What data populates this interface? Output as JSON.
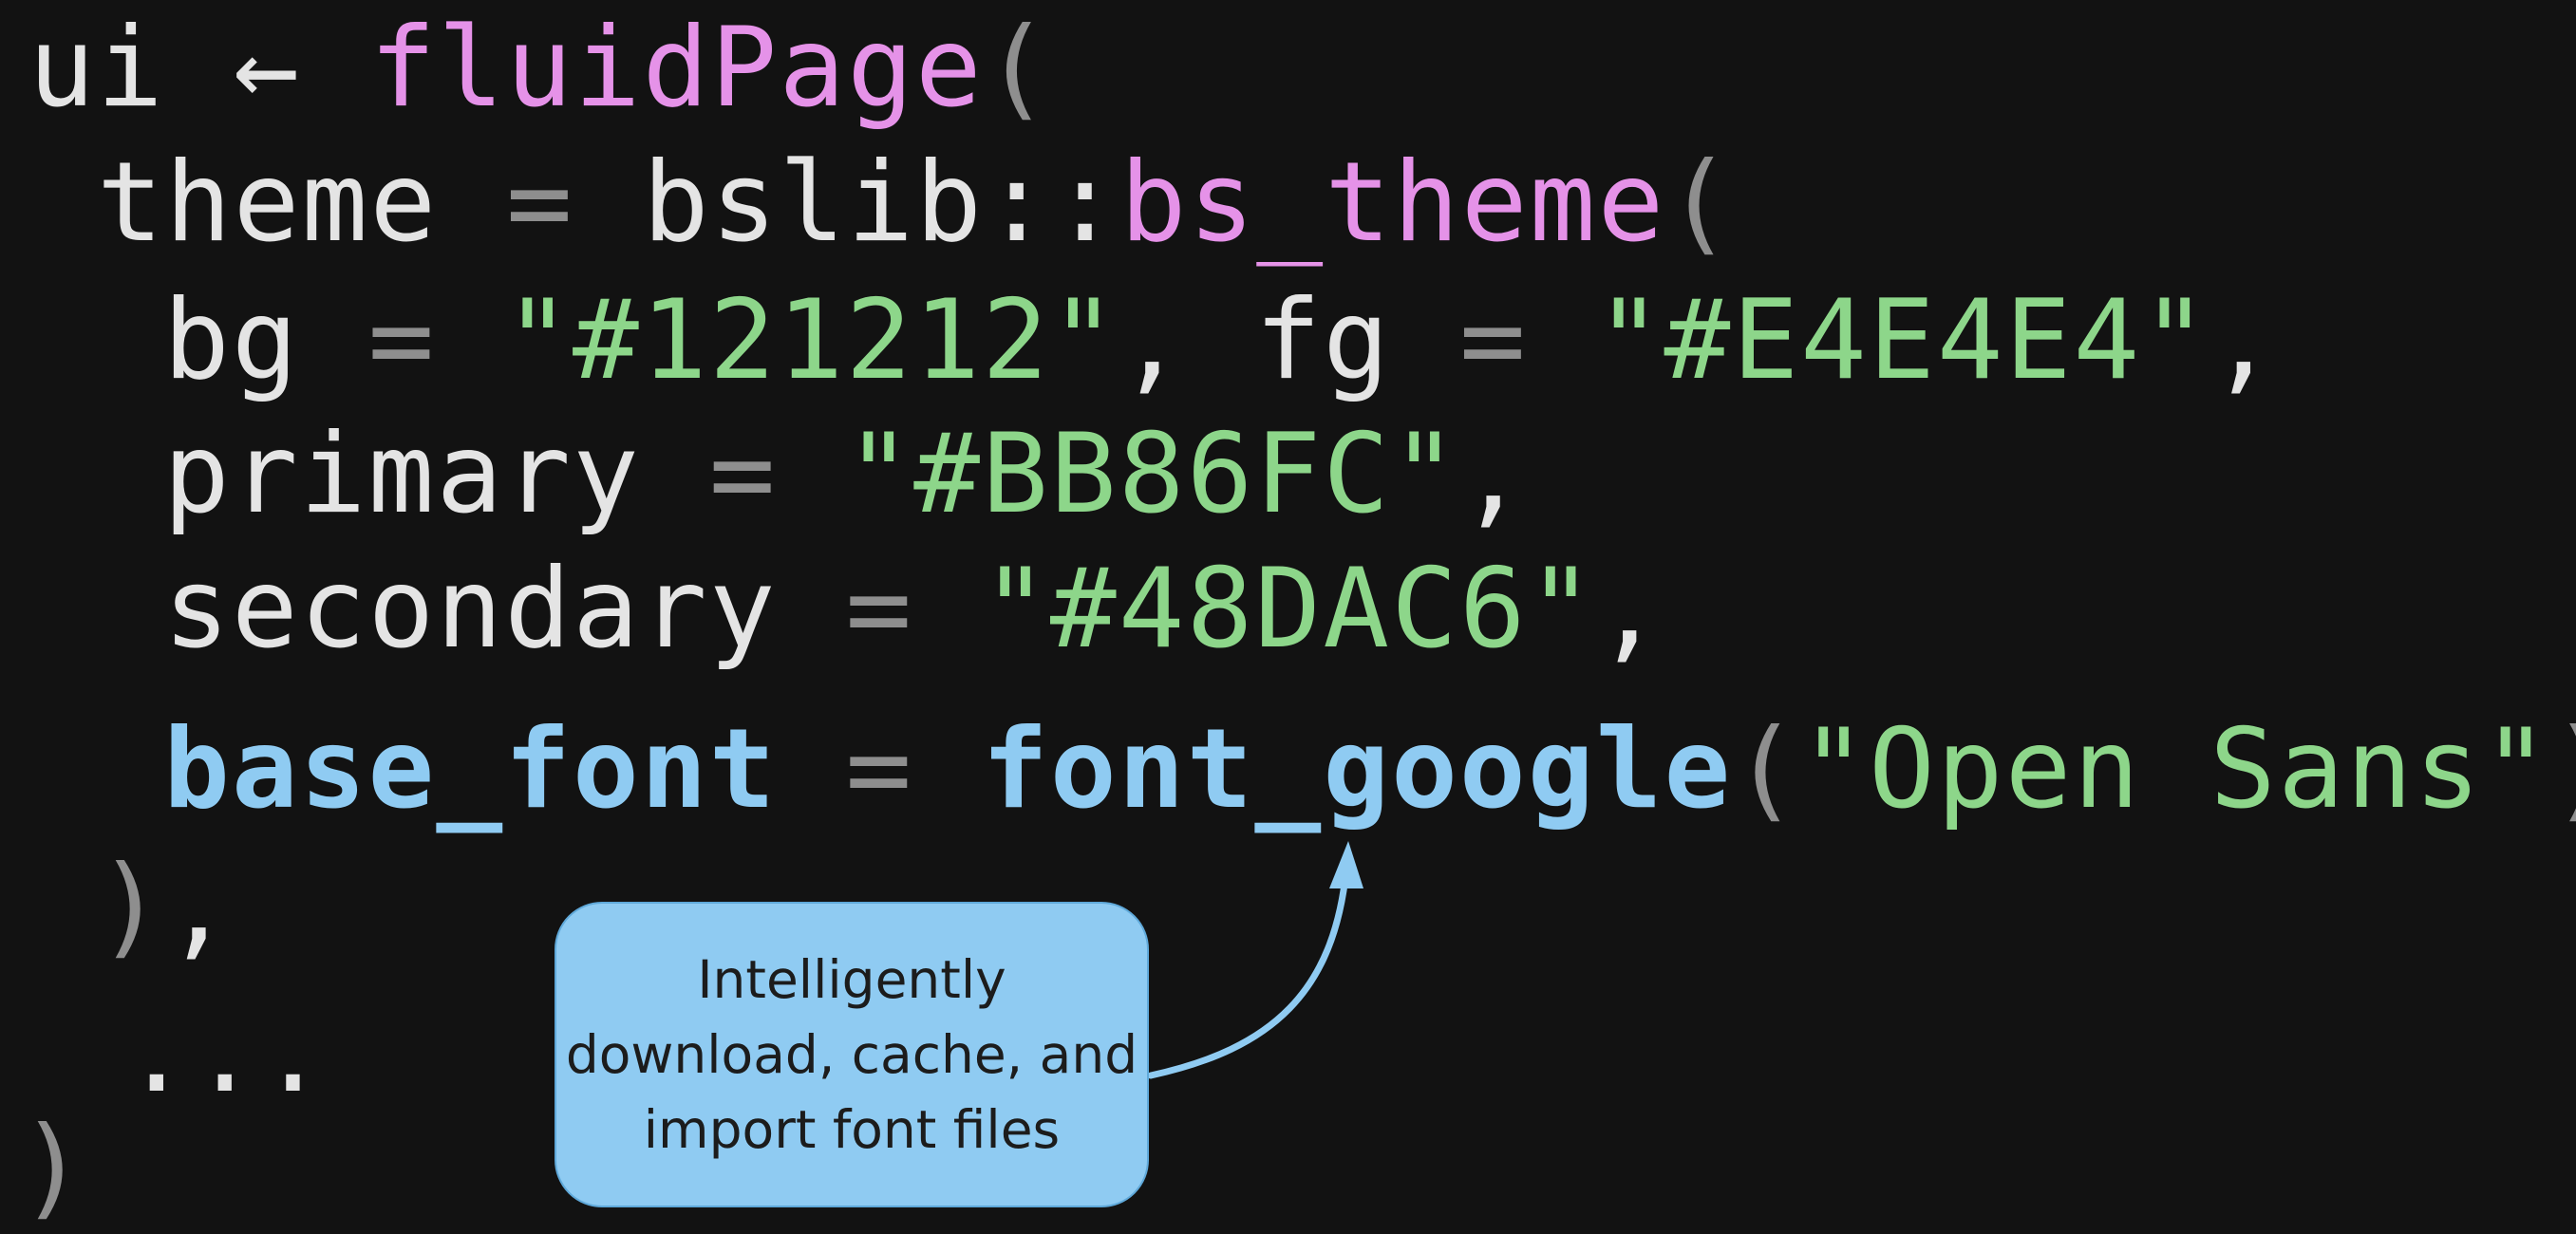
{
  "code": {
    "lines": [
      [
        {
          "text": "ui ",
          "color": "white"
        },
        {
          "text": "←",
          "color": "white"
        },
        {
          "text": " ",
          "color": "white"
        },
        {
          "text": "fluidPage",
          "color": "pink"
        },
        {
          "text": "(",
          "color": "gray"
        }
      ],
      [
        {
          "text": "theme",
          "color": "white"
        },
        {
          "text": " = ",
          "color": "gray"
        },
        {
          "text": "bslib",
          "color": "white"
        },
        {
          "text": "::",
          "color": "white"
        },
        {
          "text": "bs_theme",
          "color": "pink"
        },
        {
          "text": "(",
          "color": "gray"
        }
      ],
      [
        {
          "text": "bg",
          "color": "white"
        },
        {
          "text": " = ",
          "color": "gray"
        },
        {
          "text": "\"#121212\"",
          "color": "green"
        },
        {
          "text": ", ",
          "color": "white"
        },
        {
          "text": "fg",
          "color": "white"
        },
        {
          "text": " = ",
          "color": "gray"
        },
        {
          "text": "\"#E4E4E4\"",
          "color": "green"
        },
        {
          "text": ",",
          "color": "white"
        }
      ],
      [
        {
          "text": "primary",
          "color": "white"
        },
        {
          "text": " = ",
          "color": "gray"
        },
        {
          "text": "\"#BB86FC\"",
          "color": "green"
        },
        {
          "text": ",",
          "color": "white"
        }
      ],
      [
        {
          "text": "secondary",
          "color": "white"
        },
        {
          "text": " = ",
          "color": "gray"
        },
        {
          "text": "\"#48DAC6\"",
          "color": "green"
        },
        {
          "text": ",",
          "color": "white"
        }
      ],
      [
        {
          "text": "base_font",
          "color": "blue"
        },
        {
          "text": " = ",
          "color": "gray"
        },
        {
          "text": "font_google",
          "color": "blue"
        },
        {
          "text": "(",
          "color": "gray"
        },
        {
          "text": "\"Open Sans\"",
          "color": "green"
        },
        {
          "text": ")",
          "color": "gray"
        }
      ],
      [
        {
          "text": ")",
          "color": "gray"
        },
        {
          "text": ",",
          "color": "white"
        }
      ],
      [
        {
          "text": "...",
          "color": "white"
        }
      ],
      [
        {
          "text": ")",
          "color": "gray"
        }
      ]
    ]
  },
  "callout": {
    "text": "Intelligently\ndownload, cache, and\nimport font files"
  },
  "colors": {
    "background": "#121212",
    "white": "#E4E4E4",
    "pink": "#E592E8",
    "green": "#8DD68A",
    "gray": "#8E8E8E",
    "blue": "#8FCBF2"
  }
}
